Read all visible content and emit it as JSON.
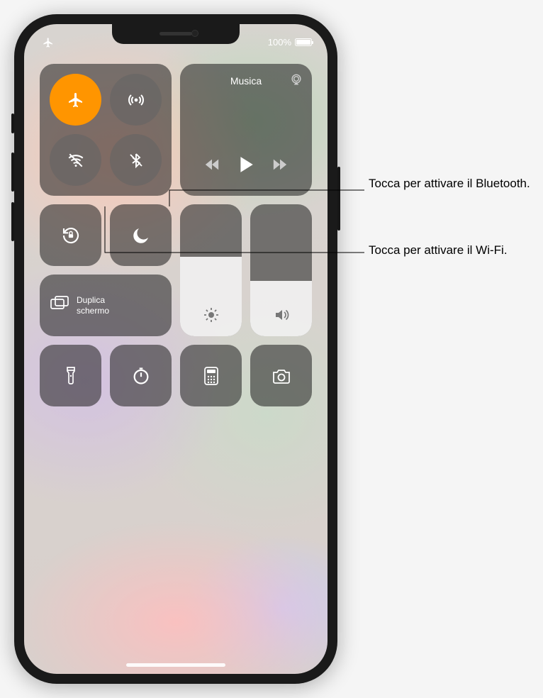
{
  "status": {
    "battery_text": "100%"
  },
  "connectivity": {
    "airplane": "airplane-icon",
    "cellular": "cellular-icon",
    "wifi": "wifi-off-icon",
    "bluetooth": "bluetooth-off-icon"
  },
  "music": {
    "title": "Musica"
  },
  "screen_mirroring": {
    "line1": "Duplica",
    "line2": "schermo"
  },
  "sliders": {
    "brightness_pct": 60,
    "volume_pct": 42
  },
  "callouts": {
    "bluetooth": "Tocca per attivare il Bluetooth.",
    "wifi": "Tocca per attivare il Wi-Fi."
  }
}
